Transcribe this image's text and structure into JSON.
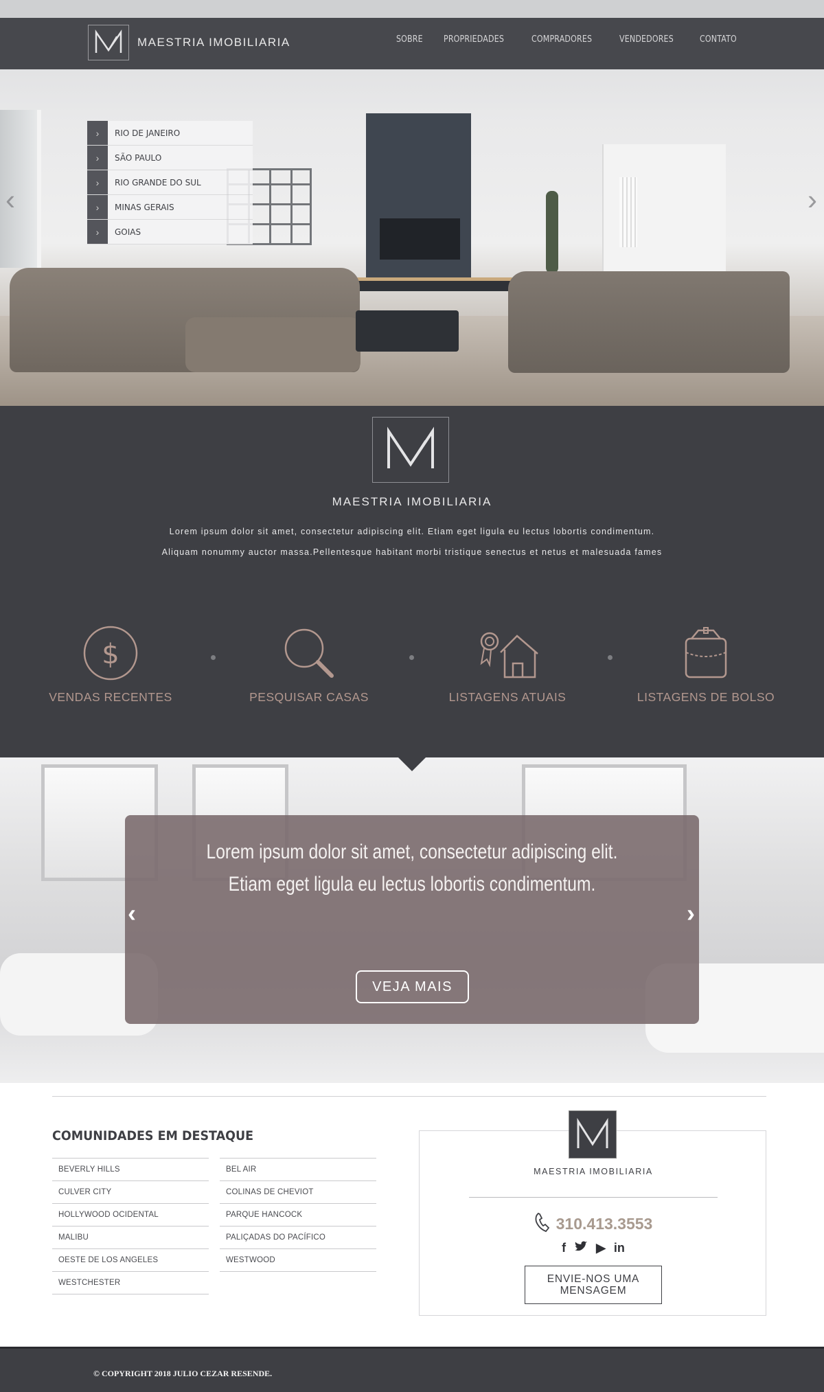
{
  "brand": {
    "name": "MAESTRIA IMOBILIARIA"
  },
  "nav": [
    "SOBRE",
    "PROPRIEDADES",
    "COMPRADORES",
    "VENDEDORES",
    "CONTATO"
  ],
  "regions": [
    "RIO DE JANEIRO",
    "SÃO PAULO",
    "RIO GRANDE DO SUL",
    "MINAS GERAIS",
    "GOIAS"
  ],
  "intro": {
    "line1": "Lorem ipsum dolor sit amet, consectetur adipiscing elit. Etiam eget ligula eu lectus lobortis condimentum.",
    "line2": "Aliquam nonummy auctor massa.Pellentesque habitant morbi tristique senectus et netus et malesuada fames"
  },
  "features": [
    {
      "label": "VENDAS RECENTES",
      "icon": "dollar-circle-icon"
    },
    {
      "label": "PESQUISAR CASAS",
      "icon": "magnifier-icon"
    },
    {
      "label": "LISTAGENS ATUAIS",
      "icon": "house-award-icon"
    },
    {
      "label": "LISTAGENS DE BOLSO",
      "icon": "pocket-bag-icon"
    }
  ],
  "slide": {
    "line1": "Lorem ipsum dolor sit amet, consectetur adipiscing elit.",
    "line2": "Etiam eget ligula eu lectus lobortis condimentum.",
    "button": "VEJA MAIS"
  },
  "communities": {
    "title": "COMUNIDADES EM DESTAQUE",
    "col1": [
      "BEVERLY HILLS",
      "CULVER CITY",
      "HOLLYWOOD OCIDENTAL",
      "MALIBU",
      "OESTE DE LOS ANGELES",
      "WESTCHESTER"
    ],
    "col2": [
      "BEL AIR",
      "COLINAS DE CHEVIOT",
      "PARQUE HANCOCK",
      "PALIÇADAS DO PACÍFICO",
      "WESTWOOD"
    ]
  },
  "contact": {
    "phone": "310.413.3553",
    "button_line1": "ENVIE-NOS UMA",
    "button_line2": "MENSAGEM"
  },
  "footer": {
    "copyright": "© COPYRIGHT 2018 JULIO CEZAR RESENDE."
  },
  "colors": {
    "dark": "#3e3f44",
    "accent": "#b3988f",
    "card": "#79696b"
  }
}
